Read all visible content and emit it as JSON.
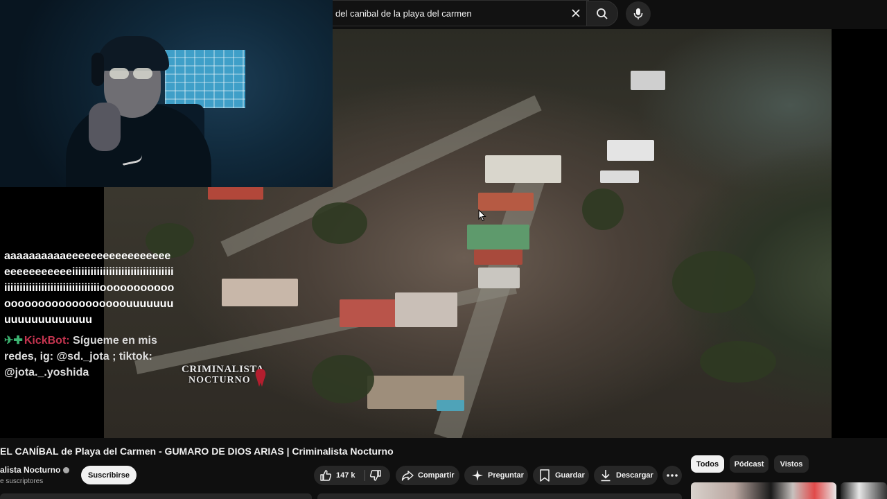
{
  "search": {
    "query": "del canibal de la playa del carmen",
    "clear_icon": "close-icon",
    "search_icon": "search-icon",
    "mic_icon": "microphone-icon"
  },
  "overlay": {
    "chat_message": "aaaaaaaaaaeeeeeeeeeeeeeeeeeeeeeeeeeeeeiiiiiiiiiiiiiiiiiiiiiiiiiiiiiiiiiiiiiiiiiiiiiiiiiiiiiiiiiiiiiiiiooooooooooooooooooooooooooooouuuuuuuuuuuuuuuuuuuu",
    "bot_name": "KickBot",
    "bot_text": "Sígueme en mis redes, ig: @sd._jota ; tiktok: @jota._.yoshida"
  },
  "video": {
    "watermark_line1": "CRIMINALISTA",
    "watermark_line2": "NOCTURNO",
    "title": "EL CANÍBAL de Playa del Carmen - GUMARO DE DIOS ARIAS | Criminalista Nocturno"
  },
  "channel": {
    "name": "alista Nocturno",
    "subscribers": "e suscriptores",
    "subscribe_label": "Suscribirse"
  },
  "actions": {
    "like_count": "147 k",
    "share_label": "Compartir",
    "ask_label": "Preguntar",
    "save_label": "Guardar",
    "download_label": "Descargar"
  },
  "chips": {
    "all": "Todos",
    "podcast": "Pódcast",
    "watched": "Vistos",
    "active": "all"
  },
  "colors": {
    "background": "#0f0f0f",
    "pill": "#272727",
    "bot_name": "#c4344f",
    "bot_icons": "#3cb371"
  }
}
